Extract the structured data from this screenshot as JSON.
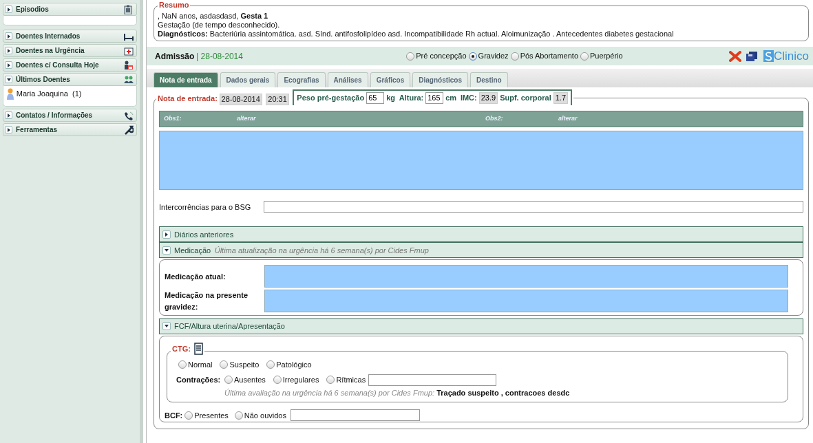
{
  "sidebar": {
    "sections": [
      {
        "label": "Episodios",
        "expanded": false
      },
      {
        "label": "Doentes Internados",
        "expanded": false
      },
      {
        "label": "Doentes na Urgência",
        "expanded": false
      },
      {
        "label": "Doentes c/ Consulta Hoje",
        "expanded": false
      },
      {
        "label": "Últimos Doentes",
        "expanded": true,
        "items": [
          {
            "label": "Maria Joaquina  (1)"
          }
        ]
      },
      {
        "label": "Contatos / Informações",
        "expanded": false
      },
      {
        "label": "Ferramentas",
        "expanded": false
      }
    ]
  },
  "summary": {
    "title": "Resumo",
    "lines": [
      ", NaN anos, asdasdasd, **Gesta 1**",
      "Gestação (de tempo desconhecido).",
      "**Diagnósticos:** Bacteriúria assintomática. asd. Sínd. antifosfolipídeo asd. Incompatibilidade Rh actual. Aloimunização . Antecedentes diabetes gestacional"
    ]
  },
  "header": {
    "title": "Admissão",
    "date": "| 28-08-2014",
    "states": [
      {
        "label": "Pré concepção",
        "selected": false
      },
      {
        "label": "Gravidez",
        "selected": true
      },
      {
        "label": "Pós Abortamento",
        "selected": false
      },
      {
        "label": "Puerpério",
        "selected": false
      }
    ],
    "logo_text": "Clinico"
  },
  "tabs": [
    {
      "label": "Nota de entrada",
      "selected": true
    },
    {
      "label": "Dados gerais",
      "selected": false
    },
    {
      "label": "Ecografias",
      "selected": false
    },
    {
      "label": "Análises",
      "selected": false
    },
    {
      "label": "Gráficos",
      "selected": false
    },
    {
      "label": "Diagnósticos",
      "selected": false
    },
    {
      "label": "Destino",
      "selected": false
    }
  ],
  "entry": {
    "label": "Nota de entrada:",
    "date": "28-08-2014",
    "time": "20:31",
    "measures": [
      {
        "label": "Peso pré-gestação",
        "value": "65",
        "unit": "kg",
        "kind": "input"
      },
      {
        "label": "Altura:",
        "value": "165",
        "unit": "cm",
        "kind": "input"
      },
      {
        "label": "IMC:",
        "value": "23.9",
        "kind": "readonly"
      },
      {
        "label": "Supf. corporal",
        "value": "1.7",
        "kind": "readonly"
      }
    ],
    "obs": [
      {
        "label": "Obs1:",
        "link": "alterar"
      },
      {
        "label": "Obs2:",
        "link": "alterar"
      }
    ],
    "intercurrences_label": "Intercorrências para o BSG"
  },
  "panels": [
    {
      "title": "Diários anteriores",
      "expanded": false
    },
    {
      "title": "Medicação",
      "note": "Última atualização na urgência há 6 semana(s) por Cides Fmup",
      "expanded": true,
      "kind": "medication",
      "fields": [
        "Medicação atual:",
        "Medicação na presente gravidez:"
      ]
    },
    {
      "title": "FCF/Altura uterina/Apresentação",
      "expanded": true,
      "kind": "fcf",
      "ctg": {
        "title": "CTG:",
        "options": [
          {
            "label": "Normal",
            "selected": false
          },
          {
            "label": "Suspeito",
            "selected": false
          },
          {
            "label": "Patológico",
            "selected": false
          }
        ],
        "contractions_label": "Contrações:",
        "contractions": [
          {
            "label": "Ausentes",
            "selected": false
          },
          {
            "label": "Irregulares",
            "selected": false
          },
          {
            "label": "Rítmicas",
            "selected": false
          }
        ],
        "note": "*Última avaliação na urgência há 6 semana(s) por Cides Fmup:* **Traçado suspeito , contracoes desdc**"
      },
      "bcf_label": "BCF:",
      "bcf": [
        {
          "label": "Presentes",
          "selected": false
        },
        {
          "label": "Não ouvidos",
          "selected": false
        }
      ]
    }
  ]
}
